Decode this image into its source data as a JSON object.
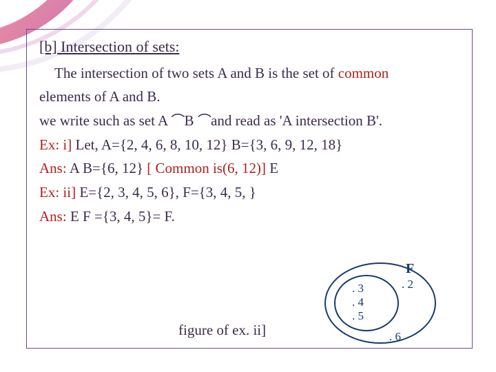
{
  "title": "[b] Intersection of sets:",
  "para1": "   The intersection of two sets A and B is the set of ",
  "para1_red": "common",
  "para2": "elements of A and B.",
  "line_write_pre": " we write such as set A ",
  "line_write_mid": "B",
  "line_write_post": " and read as 'A intersection B'.",
  "ex1_label": "Ex: i]",
  "ex1_body": " Let,    A={2, 4, 6, 8, 10, 12}  B={3, 6, 9, 12, 18}",
  "ans1_label": "Ans:",
  "ans1_body_a": "  A   B={6, 12} ",
  "ans1_red": "[ Common is(6, 12)]",
  "ans1_body_b": "    E",
  "ex2_label": "Ex: ii]",
  "ex2_body": " E={2, 3, 4, 5, 6},  F={3, 4, 5, }",
  "ans2_label": "Ans:",
  "ans2_body": " E    F ={3, 4, 5}= F.",
  "caption": "figure of ex. ii]",
  "venn": {
    "label_F": "F",
    "p2": ". 2",
    "p3": ". 3",
    "p4": ". 4",
    "p5": ". 5",
    "p6": ". 6"
  },
  "cap_glyph": "⌒"
}
